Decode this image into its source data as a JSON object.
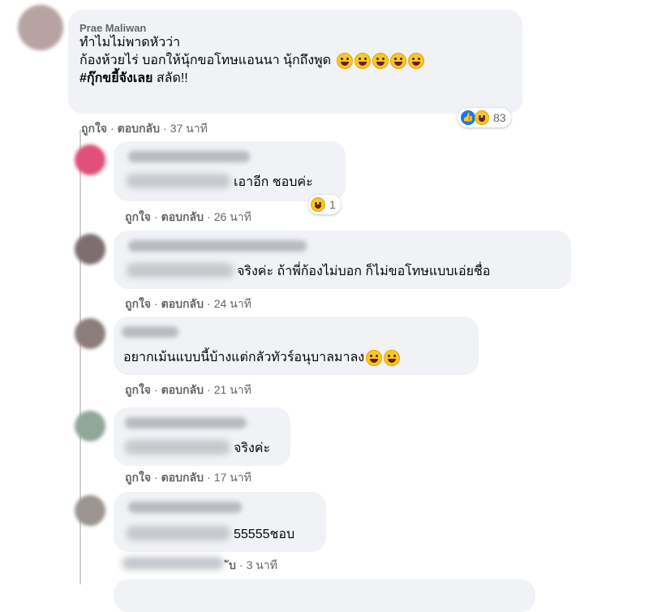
{
  "comments": [
    {
      "author": "Prae Maliwan",
      "lines": [
        "ทำไมไม่พาดหัวว่า",
        "ก้องห้วยไร่ บอกให้นุ้กขอโทษแอนนา นุ้กถึงพูด"
      ],
      "hashtag": "#กุ๊กขยี้จังเลย",
      "tail": " สลัด!!",
      "like_label": "ถูกใจ",
      "reply_label": "ตอบกลับ",
      "time": "37 นาที",
      "reaction_count": "83"
    },
    {
      "text": "เอาอีก ชอบค่ะ",
      "like_label": "ถูกใจ",
      "reply_label": "ตอบกลับ",
      "time": "26 นาที",
      "reaction_count": "1"
    },
    {
      "text": "จริงค่ะ ถ้าพี่ก้องไม่บอก ก็ไม่ขอโทษแบบเอ่ยชื่อ",
      "like_label": "ถูกใจ",
      "reply_label": "ตอบกลับ",
      "time": "24 นาที"
    },
    {
      "text": "อยากเม้นแบบนี้บ้างแต่กลัวทัวร์อนุบาลมาลง",
      "like_label": "ถูกใจ",
      "reply_label": "ตอบกลับ",
      "time": "21 นาที"
    },
    {
      "text": "จริงค่ะ",
      "like_label": "ถูกใจ",
      "reply_label": "ตอบกลับ",
      "time": "17 นาที"
    },
    {
      "text": "55555ชอบ",
      "reply_label": "ับ",
      "time": "3 นาที"
    }
  ],
  "icons": {
    "laugh": "laughing-emoji-icon",
    "like": "like-reaction-icon"
  }
}
